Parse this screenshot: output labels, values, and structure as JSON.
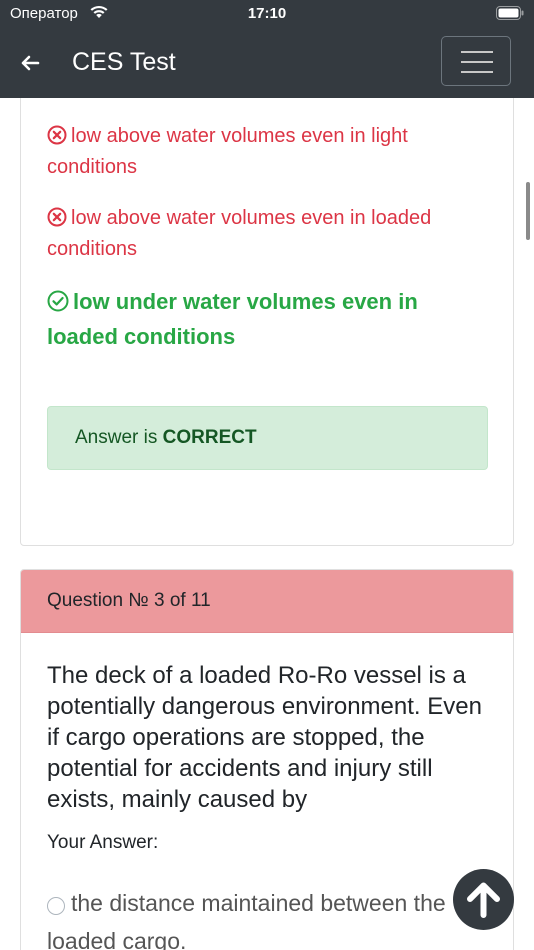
{
  "status": {
    "carrier": "Оператор",
    "time": "17:10"
  },
  "navbar": {
    "title": "CES Test"
  },
  "previous_question": {
    "options": [
      {
        "text": "conditions",
        "state": "wrong-continuation"
      },
      {
        "text": "low above water volumes even in light conditions",
        "state": "wrong"
      },
      {
        "text": "low above water volumes even in loaded conditions",
        "state": "wrong"
      },
      {
        "text": "low under water volumes even in loaded conditions",
        "state": "correct"
      }
    ],
    "result_prefix": "Answer is ",
    "result_value": "CORRECT"
  },
  "current_question": {
    "header": "Question № 3 of 11",
    "text": "The deck of a loaded Ro-Ro vessel is a potentially dangerous environment. Even if cargo operations are stopped, the potential for accidents and injury still exists, mainly caused by",
    "your_answer_label": "Your Answer:",
    "choices": [
      {
        "text": "the distance maintained between the loaded cargo."
      }
    ]
  },
  "colors": {
    "navbar": "#343a40",
    "wrong": "#dc3545",
    "correct": "#28a745",
    "header_bg": "#ec999c",
    "alert_bg": "#d4edda"
  },
  "icons": {
    "back": "arrow-left-icon",
    "menu": "hamburger-icon",
    "wrong": "x-circle-icon",
    "correct": "check-circle-icon",
    "scroll_top": "arrow-up-icon"
  }
}
